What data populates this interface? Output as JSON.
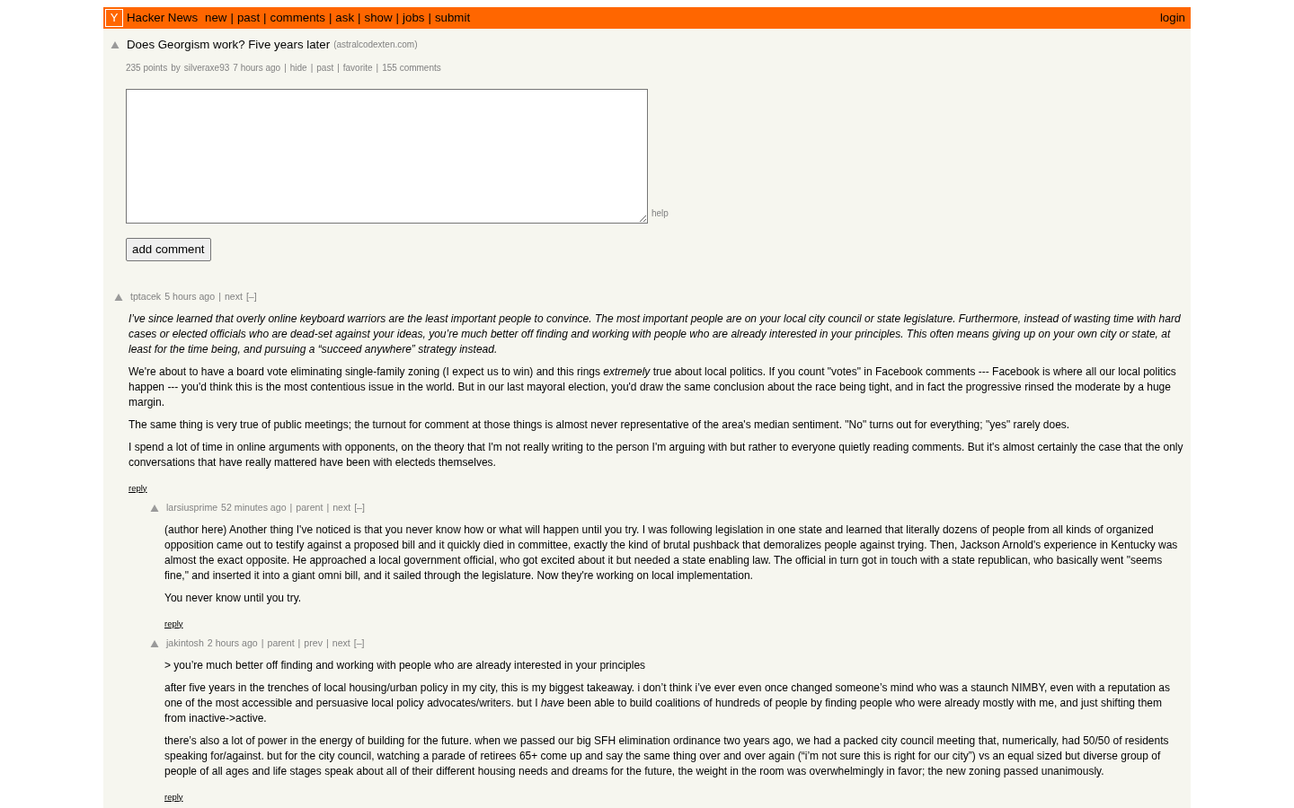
{
  "header": {
    "logo": "Y",
    "site_name": "Hacker News",
    "links": [
      "new",
      "past",
      "comments",
      "ask",
      "show",
      "jobs",
      "submit"
    ],
    "separator": "|",
    "login": "login"
  },
  "story": {
    "title": "Does Georgism work? Five years later",
    "site": "(astralcodexten.com)",
    "points": "235 points",
    "by": "by",
    "user": "silveraxe93",
    "age": "7 hours ago",
    "links": [
      "hide",
      "past",
      "favorite",
      "155 comments"
    ],
    "separator": "|"
  },
  "comment_form": {
    "help": "help",
    "button": "add comment"
  },
  "comments": [
    {
      "user": "tptacek",
      "age": "5 hours ago",
      "links": [
        "next"
      ],
      "separator": "|",
      "toggle": "[–]",
      "paragraphs": [
        {
          "text": "I’ve since learned that overly online keyboard warriors are the least important people to convince. The most important people are on your local city council or state legislature. Furthermore, instead of wasting time with hard cases or elected officials who are dead-set against your ideas, you’re much better off finding and working with people who are already interested in your principles. This often means giving up on your own city or state, at least for the time being, and pursuing a “succeed anywhere” strategy instead.",
          "italic": true
        },
        {
          "text": "We're about to have a board vote eliminating single-family zoning (I expect us to win) and this rings *extremely* true about local politics. If you count \"votes\" in Facebook comments --- Facebook is where all our local politics happen --- you'd think this is the most contentious issue in the world. But in our last mayoral election, you'd draw the same conclusion about the race being tight, and in fact the progressive rinsed the moderate by a huge margin.",
          "italic": false
        },
        {
          "text": "The same thing is very true of public meetings; the turnout for comment at those things is almost never representative of the area's median sentiment. \"No\" turns out for everything; \"yes\" rarely does.",
          "italic": false
        },
        {
          "text": "I spend a lot of time in online arguments with opponents, on the theory that I'm not really writing to the person I'm arguing with but rather to everyone quietly reading comments. But it's almost certainly the case that the only conversations that have really mattered have been with electeds themselves.",
          "italic": false
        }
      ],
      "reply": "reply",
      "children": [
        {
          "user": "larsiusprime",
          "age": "52 minutes ago",
          "links": [
            "parent",
            "next"
          ],
          "separator": "|",
          "toggle": "[–]",
          "paragraphs": [
            {
              "text": "(author here) Another thing I've noticed is that you never know how or what will happen until you try. I was following legislation in one state and learned that literally dozens of people from all kinds of organized opposition came out to testify against a proposed bill and it quickly died in committee, exactly the kind of brutal pushback that demoralizes people against trying. Then, Jackson Arnold's experience in Kentucky was almost the exact opposite. He approached a local government official, who got excited about it but needed a state enabling law. The official in turn got in touch with a state republican, who basically went \"seems fine,\" and inserted it into a giant omni bill, and it sailed through the legislature. Now they're working on local implementation.",
              "italic": false
            },
            {
              "text": "You never know until you try.",
              "italic": false
            }
          ],
          "reply": "reply"
        },
        {
          "user": "jakintosh",
          "age": "2 hours ago",
          "links": [
            "parent",
            "prev",
            "next"
          ],
          "separator": "|",
          "toggle": "[–]",
          "paragraphs": [
            {
              "text": "> you’re much better off finding and working with people who are already interested in your principles",
              "italic": false
            },
            {
              "text": "after five years in the trenches of local housing/urban policy in my city, this is my biggest takeaway. i don’t think i’ve ever even once changed someone’s mind who was a staunch NIMBY, even with a reputation as one of the most accessible and persuasive local policy advocates/writers. but I *have* been able to build coalitions of hundreds of people by finding people who were already mostly with me, and just shifting them from inactive->active.",
              "italic": false
            },
            {
              "text": "there’s also a lot of power in the energy of building for the future. when we passed our big SFH elimination ordinance two years ago, we had a packed city council meeting that, numerically, had 50/50 of residents speaking for/against. but for the city council, watching a parade of retirees 65+ come up and say the same thing over and over again (“i’m not sure this is right for our city”) vs an equal sized but diverse group of people of all ages and life stages speak about all of their different housing needs and dreams for the future, the weight in the room was overwhelmingly in favor; the new zoning passed unanimously.",
              "italic": false
            }
          ],
          "reply": "reply"
        }
      ]
    }
  ]
}
